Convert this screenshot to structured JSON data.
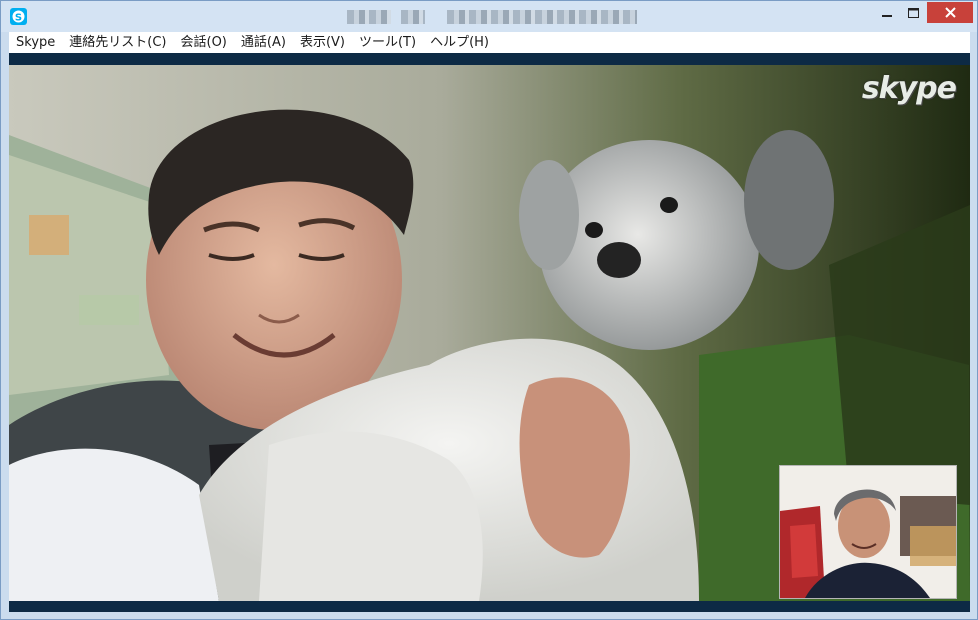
{
  "window": {
    "title": "▇▇▇▇ ▇▇   ▇▇▇▇▇▇▇▇▇▇▇▇▇▇▇▇",
    "controls": {
      "minimize_icon": "minimize-icon",
      "maximize_icon": "maximize-icon",
      "close_icon": "close-icon"
    }
  },
  "menu": {
    "items": [
      {
        "label": "Skype"
      },
      {
        "label": "連絡先リスト(C)"
      },
      {
        "label": "会話(O)"
      },
      {
        "label": "通話(A)"
      },
      {
        "label": "表示(V)"
      },
      {
        "label": "ツール(T)"
      },
      {
        "label": "ヘルプ(H)"
      }
    ]
  },
  "video": {
    "watermark": "skype",
    "remote_feed": "man-holding-poodle",
    "self_view": "man-in-red-chair"
  },
  "colors": {
    "titlebar": "#d4e3f3",
    "close_button": "#c8413a",
    "call_band": "#0d2a45",
    "skype_blue": "#00aff0"
  }
}
